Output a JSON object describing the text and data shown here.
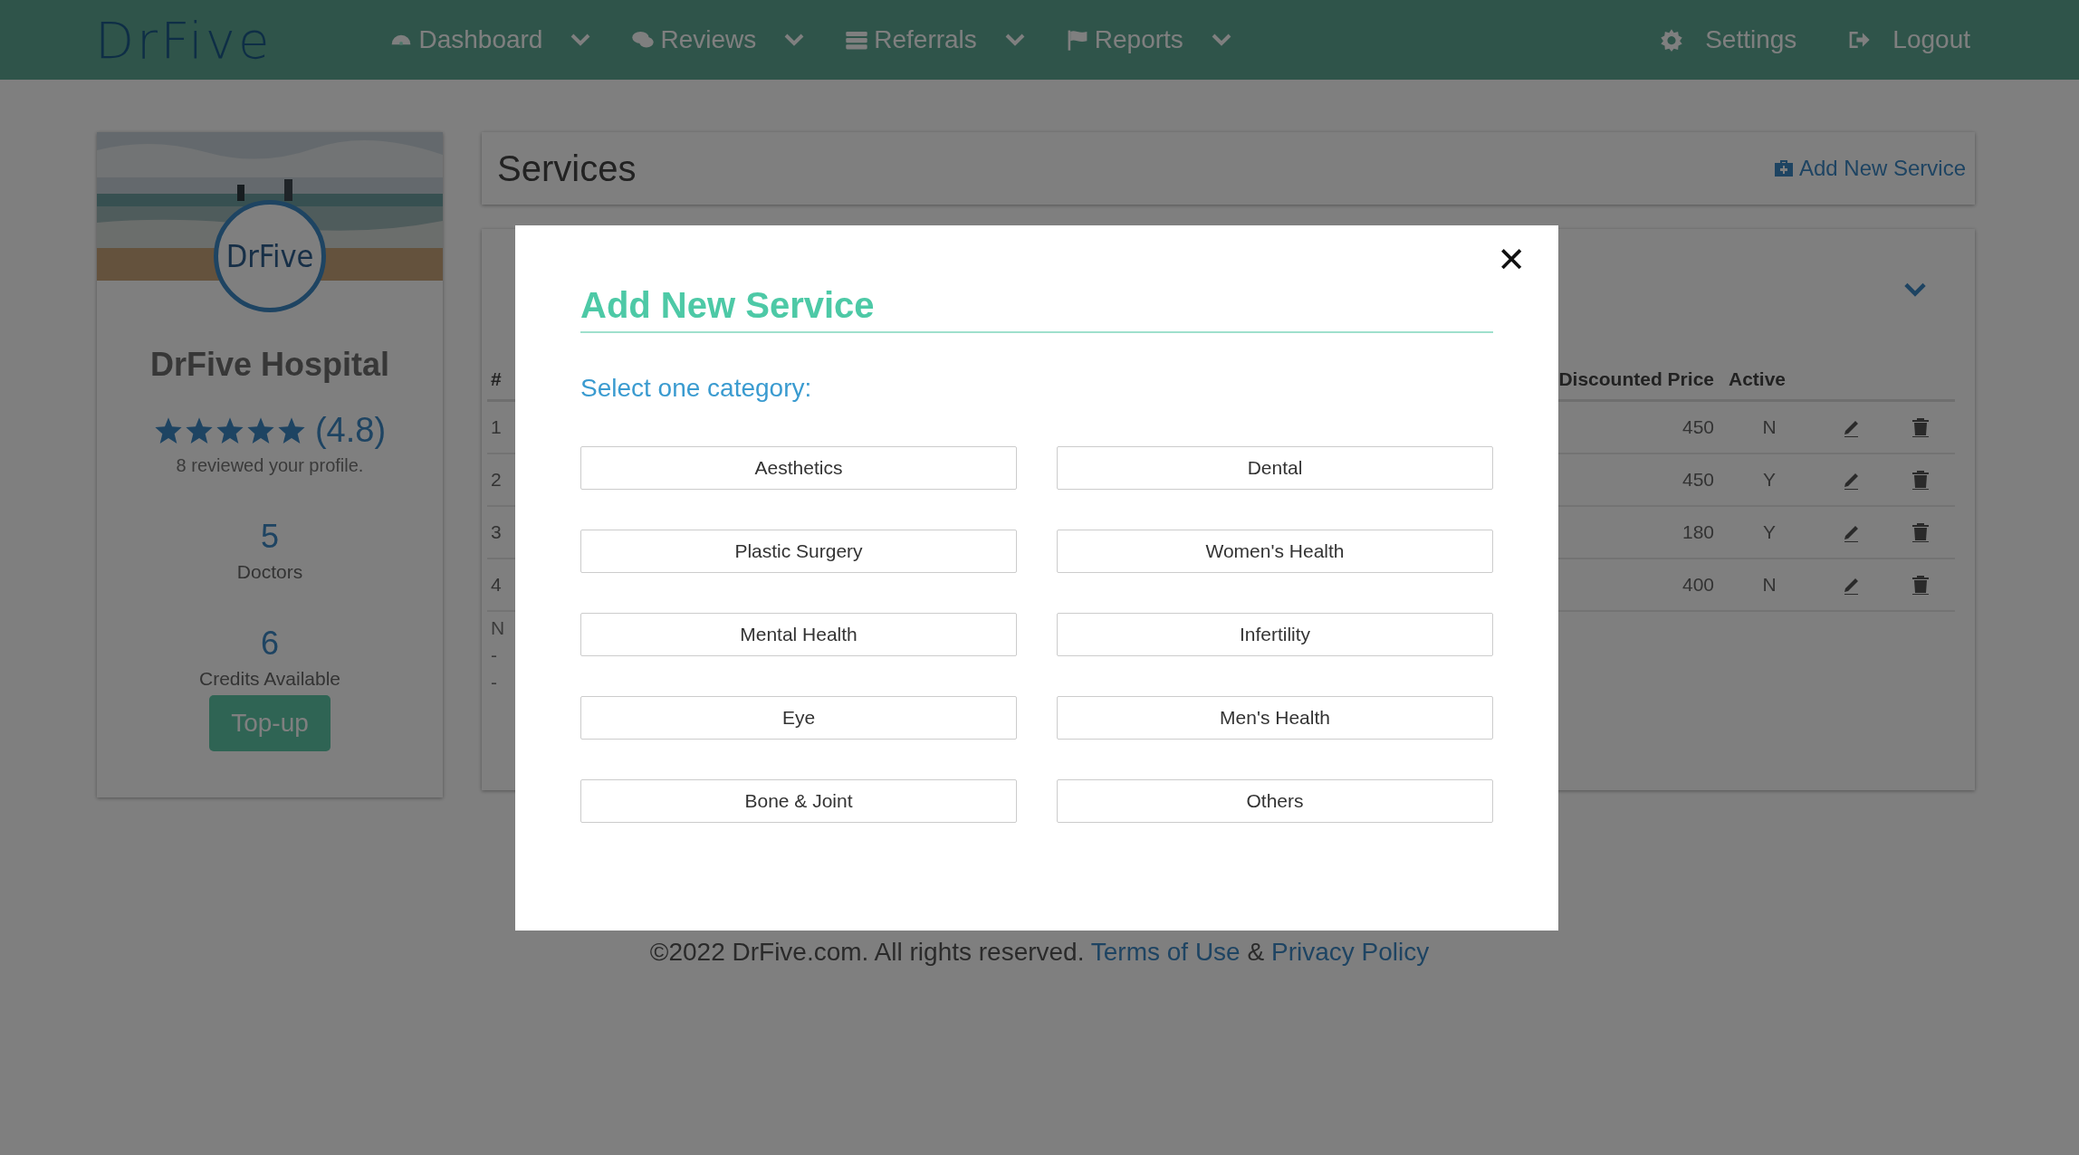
{
  "nav": {
    "logo": "DrFive",
    "items": [
      {
        "label": "Dashboard"
      },
      {
        "label": "Reviews"
      },
      {
        "label": "Referrals"
      },
      {
        "label": "Reports"
      }
    ],
    "right": [
      {
        "label": "Settings"
      },
      {
        "label": "Logout"
      }
    ]
  },
  "profile": {
    "logo_text": "DrFive",
    "name": "DrFive Hospital",
    "stars": 5,
    "rating": "(4.8)",
    "reviews": "8 reviewed your profile.",
    "stats": [
      {
        "value": "5",
        "label": "Doctors"
      },
      {
        "value": "6",
        "label": "Credits Available"
      }
    ],
    "button": "Top-up"
  },
  "services": {
    "title": "Services",
    "add_link": "Add New Service",
    "table": {
      "columns": [
        "#",
        "Discounted Price",
        "Active"
      ],
      "rows": [
        {
          "number": "1",
          "discounted_price": "450",
          "active": "N"
        },
        {
          "number": "2",
          "discounted_price": "450",
          "active": "Y"
        },
        {
          "number": "3",
          "discounted_price": "180",
          "active": "Y"
        },
        {
          "number": "4",
          "discounted_price": "400",
          "active": "N"
        }
      ]
    },
    "notes": [
      "N",
      "-",
      "-"
    ]
  },
  "footer": {
    "copyright": "©2022 DrFive.com. All rights reserved.",
    "terms": "Terms of Use",
    "separator": "&",
    "privacy": "Privacy Policy"
  },
  "modal": {
    "title": "Add New Service",
    "prompt": "Select one category:",
    "close": "✕",
    "categories": [
      "Aesthetics",
      "Dental",
      "Plastic Surgery",
      "Women's Health",
      "Mental Health",
      "Infertility",
      "Eye",
      "Men's Health",
      "Bone & Joint",
      "Others"
    ]
  }
}
